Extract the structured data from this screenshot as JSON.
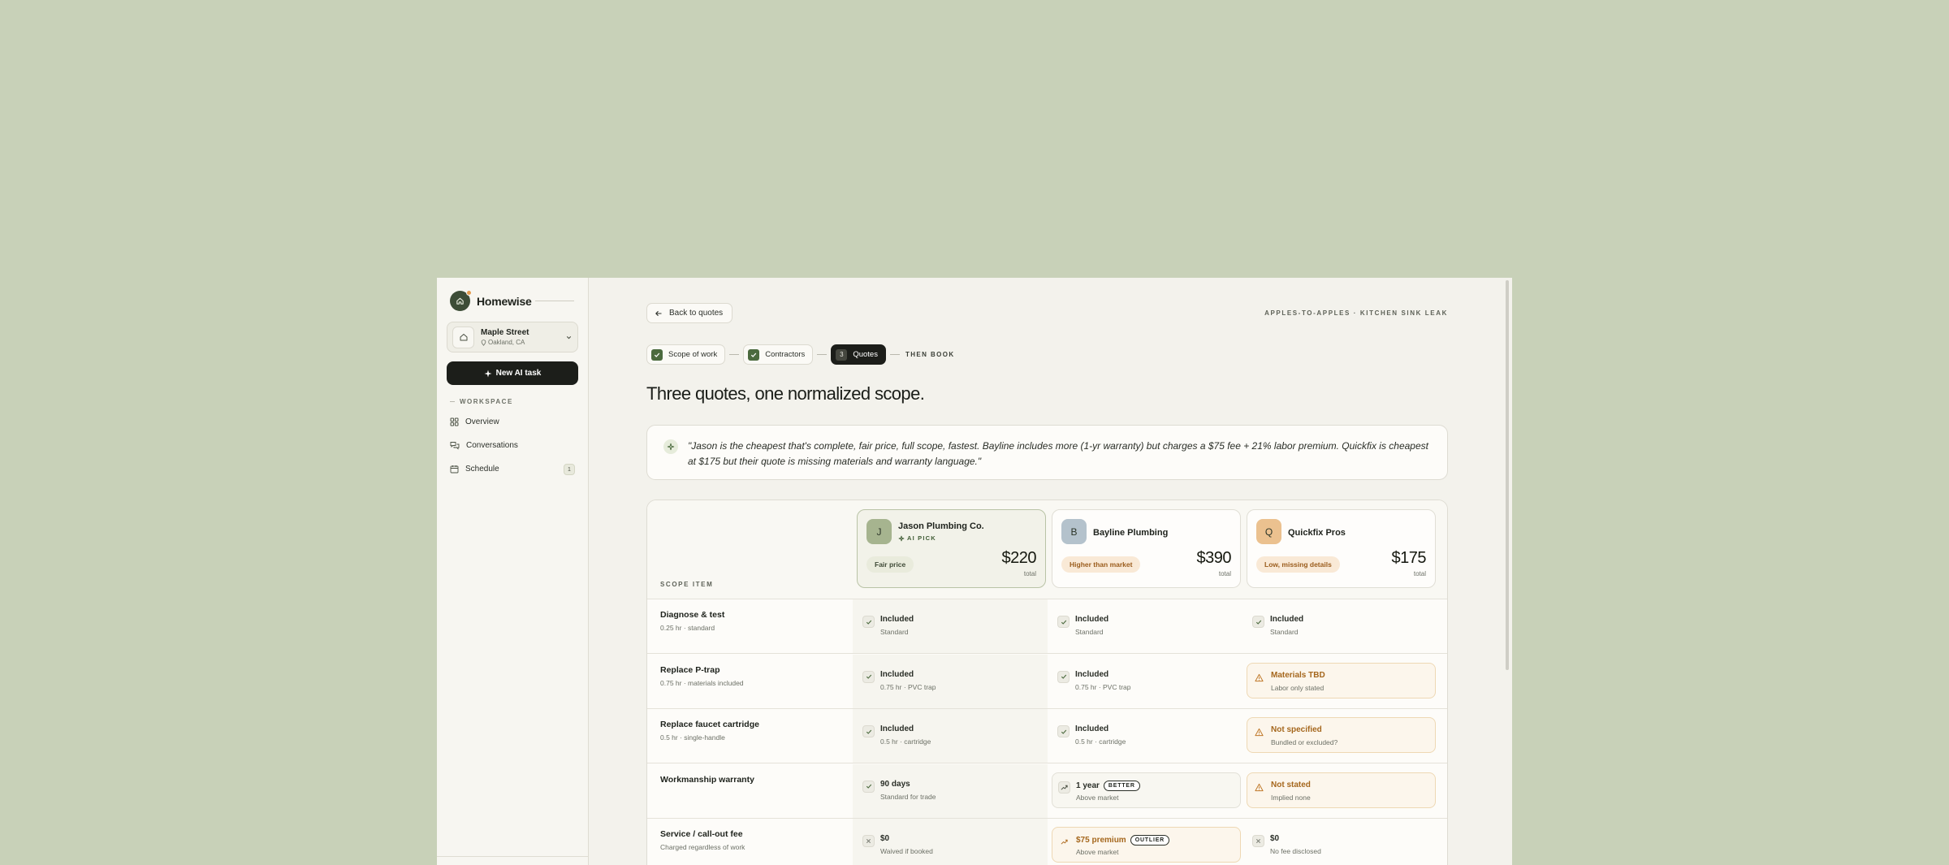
{
  "sidebar": {
    "brand": "Homewise",
    "location": {
      "name": "Maple Street",
      "sub": "Oakland, CA"
    },
    "new_task": "New AI task",
    "section": "WORKSPACE",
    "nav": [
      {
        "label": "Overview"
      },
      {
        "label": "Conversations"
      },
      {
        "label": "Schedule",
        "badge": "1"
      }
    ]
  },
  "header": {
    "back": "Back to quotes",
    "crumb": "APPLES-TO-APPLES · KITCHEN SINK LEAK",
    "steps": [
      {
        "label": "Scope of work",
        "state": "done"
      },
      {
        "label": "Contractors",
        "state": "done"
      },
      {
        "label": "Quotes",
        "state": "active",
        "num": "3"
      }
    ],
    "next_step": "THEN BOOK",
    "title": "Three quotes, one normalized scope."
  },
  "ai_summary": "\"Jason is the cheapest that's complete, fair price, full scope, fastest. Bayline includes more (1-yr warranty) but charges a $75 fee + 21% labor premium. Quickfix is cheapest at $175 but their quote is missing materials and warranty language.\"",
  "table": {
    "scope_header": "SCOPE ITEM",
    "vendors": [
      {
        "initial": "J",
        "name": "Jason Plumbing Co.",
        "badge": "AI PICK",
        "pill": "Fair price",
        "price": "$220",
        "price_sub": "total",
        "avatar_color": "#a6b48f",
        "pill_bg": "#e9ebdc",
        "pill_fg": "#3f4a37"
      },
      {
        "initial": "B",
        "name": "Bayline Plumbing",
        "pill": "Higher than market",
        "price": "$390",
        "price_sub": "total",
        "avatar_color": "#b4c2cc",
        "pill_bg": "#f9e9d6",
        "pill_fg": "#9a5c1c"
      },
      {
        "initial": "Q",
        "name": "Quickfix Pros",
        "pill": "Low, missing details",
        "price": "$175",
        "price_sub": "total",
        "avatar_color": "#ebc18f",
        "pill_bg": "#f9e9d6",
        "pill_fg": "#9a5c1c"
      }
    ],
    "rows": [
      {
        "title": "Diagnose & test",
        "sub": "0.25 hr · standard",
        "cells": [
          {
            "kind": "ok",
            "t": "Included",
            "s": "Standard"
          },
          {
            "kind": "ok",
            "t": "Included",
            "s": "Standard"
          },
          {
            "kind": "ok",
            "t": "Included",
            "s": "Standard"
          }
        ]
      },
      {
        "title": "Replace P-trap",
        "sub": "0.75 hr · materials included",
        "cells": [
          {
            "kind": "ok",
            "t": "Included",
            "s": "0.75 hr · PVC trap"
          },
          {
            "kind": "ok",
            "t": "Included",
            "s": "0.75 hr · PVC trap"
          },
          {
            "kind": "warn",
            "t": "Materials TBD",
            "s": "Labor only stated"
          }
        ]
      },
      {
        "title": "Replace faucet cartridge",
        "sub": "0.5 hr · single-handle",
        "cells": [
          {
            "kind": "ok",
            "t": "Included",
            "s": "0.5 hr · cartridge"
          },
          {
            "kind": "ok",
            "t": "Included",
            "s": "0.5 hr · cartridge"
          },
          {
            "kind": "warn",
            "t": "Not specified",
            "s": "Bundled or excluded?"
          }
        ]
      },
      {
        "title": "Workmanship warranty",
        "sub": "",
        "cells": [
          {
            "kind": "ok",
            "t": "90 days",
            "s": "Standard for trade"
          },
          {
            "kind": "up",
            "t": "1 year",
            "tag": "BETTER",
            "s": "Above market"
          },
          {
            "kind": "warn",
            "t": "Not stated",
            "s": "Implied none"
          }
        ]
      },
      {
        "title": "Service / call-out fee",
        "sub": "Charged regardless of work",
        "cells": [
          {
            "kind": "x",
            "t": "$0",
            "s": "Waived if booked"
          },
          {
            "kind": "upwarn",
            "t": "$75 premium",
            "tag": "OUTLIER",
            "s": "Above market"
          },
          {
            "kind": "x",
            "t": "$0",
            "s": "No fee disclosed"
          }
        ]
      }
    ]
  }
}
